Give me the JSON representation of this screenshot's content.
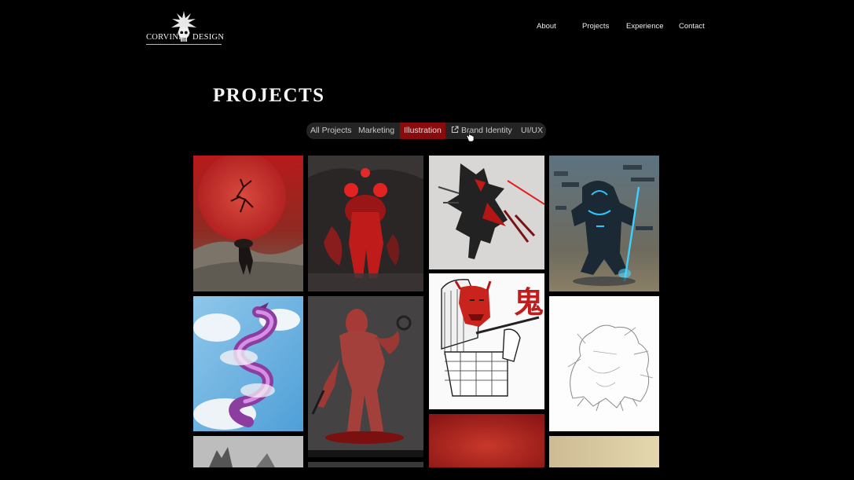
{
  "brand": {
    "word_left": "CORVINE",
    "word_right": "DESIGN",
    "logo_icon": "spiked-skull-icon"
  },
  "nav": [
    {
      "label": "About"
    },
    {
      "label": "Projects"
    },
    {
      "label": "Experience"
    },
    {
      "label": "Contact"
    }
  ],
  "page_title": "PROJECTS",
  "filters": {
    "items": [
      {
        "label": "All Projects"
      },
      {
        "label": "Marketing"
      },
      {
        "label": "Illustration",
        "active": true
      },
      {
        "label": "Brand Identity",
        "icon": "external-link-icon"
      },
      {
        "label": "UI/UX"
      }
    ]
  },
  "colors": {
    "background": "#000000",
    "filter_bar": "#242424",
    "active_filter": "#8a0b0b"
  }
}
